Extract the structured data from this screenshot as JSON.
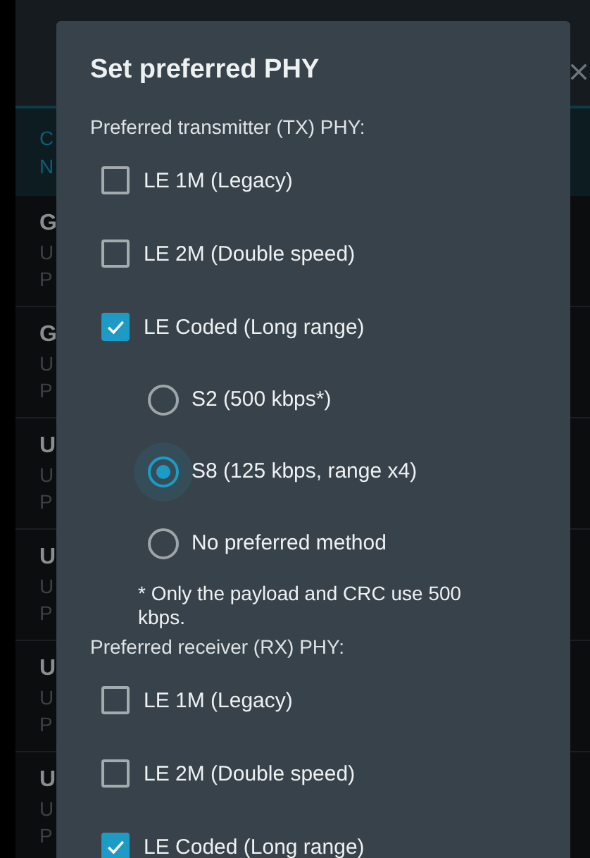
{
  "background": {
    "header": [
      "C",
      "N"
    ],
    "rows": [
      {
        "title": "G",
        "lines": [
          "U",
          "P"
        ]
      },
      {
        "title": "G",
        "lines": [
          "U",
          "P"
        ]
      },
      {
        "title": "U",
        "lines": [
          "U",
          "P"
        ]
      },
      {
        "title": "U",
        "lines": [
          "U",
          "P"
        ]
      },
      {
        "title": "U",
        "lines": [
          "U",
          "P"
        ]
      },
      {
        "title": "U",
        "lines": [
          "U",
          "P"
        ]
      }
    ]
  },
  "dialog": {
    "title": "Set preferred PHY",
    "sections": [
      {
        "label": "Preferred transmitter (TX) PHY:",
        "options": [
          {
            "label": "LE 1M (Legacy)",
            "checked": false
          },
          {
            "label": "LE 2M (Double speed)",
            "checked": false
          },
          {
            "label": "LE Coded (Long range)",
            "checked": true
          }
        ],
        "coding": [
          {
            "label": "S2 (500 kbps*)",
            "selected": false
          },
          {
            "label": "S8 (125 kbps, range x4)",
            "selected": true
          },
          {
            "label": "No preferred method",
            "selected": false
          }
        ],
        "note": "* Only the payload and CRC use 500 kbps."
      },
      {
        "label": "Preferred receiver (RX) PHY:",
        "options": [
          {
            "label": "LE 1M (Legacy)",
            "checked": false
          },
          {
            "label": "LE 2M (Double speed)",
            "checked": false
          },
          {
            "label": "LE Coded (Long range)",
            "checked": true
          }
        ]
      }
    ]
  }
}
